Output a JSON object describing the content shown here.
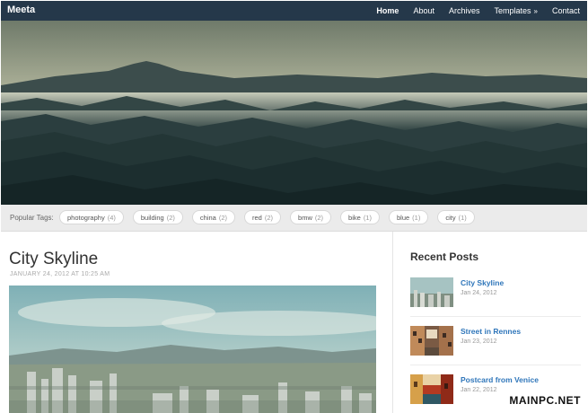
{
  "header": {
    "brand": "Meeta",
    "nav": [
      {
        "label": "Home",
        "active": true
      },
      {
        "label": "About",
        "active": false
      },
      {
        "label": "Archives",
        "active": false
      },
      {
        "label": "Templates",
        "active": false,
        "has_submenu": true,
        "caret": "»"
      },
      {
        "label": "Contact",
        "active": false
      }
    ]
  },
  "tags": {
    "label": "Popular Tags:",
    "items": [
      {
        "name": "photography",
        "count": "(4)"
      },
      {
        "name": "building",
        "count": "(2)"
      },
      {
        "name": "china",
        "count": "(2)"
      },
      {
        "name": "red",
        "count": "(2)"
      },
      {
        "name": "bmw",
        "count": "(2)"
      },
      {
        "name": "bike",
        "count": "(1)"
      },
      {
        "name": "blue",
        "count": "(1)"
      },
      {
        "name": "city",
        "count": "(1)"
      }
    ]
  },
  "post": {
    "title": "City Skyline",
    "date": "JANUARY 24, 2012 AT 10:25 AM"
  },
  "sidebar": {
    "title": "Recent Posts",
    "items": [
      {
        "title": "City Skyline",
        "date": "Jan 24, 2012",
        "thumb": "city-thumb"
      },
      {
        "title": "Street in Rennes",
        "date": "Jan 23, 2012",
        "thumb": "street-thumb"
      },
      {
        "title": "Postcard from Venice",
        "date": "Jan 22, 2012",
        "thumb": "venice-thumb"
      }
    ]
  },
  "watermark": "MAINPC.NET",
  "colors": {
    "nav_bg": "#25384a",
    "link": "#2f76ba",
    "tagbar_bg": "#ebebeb"
  }
}
